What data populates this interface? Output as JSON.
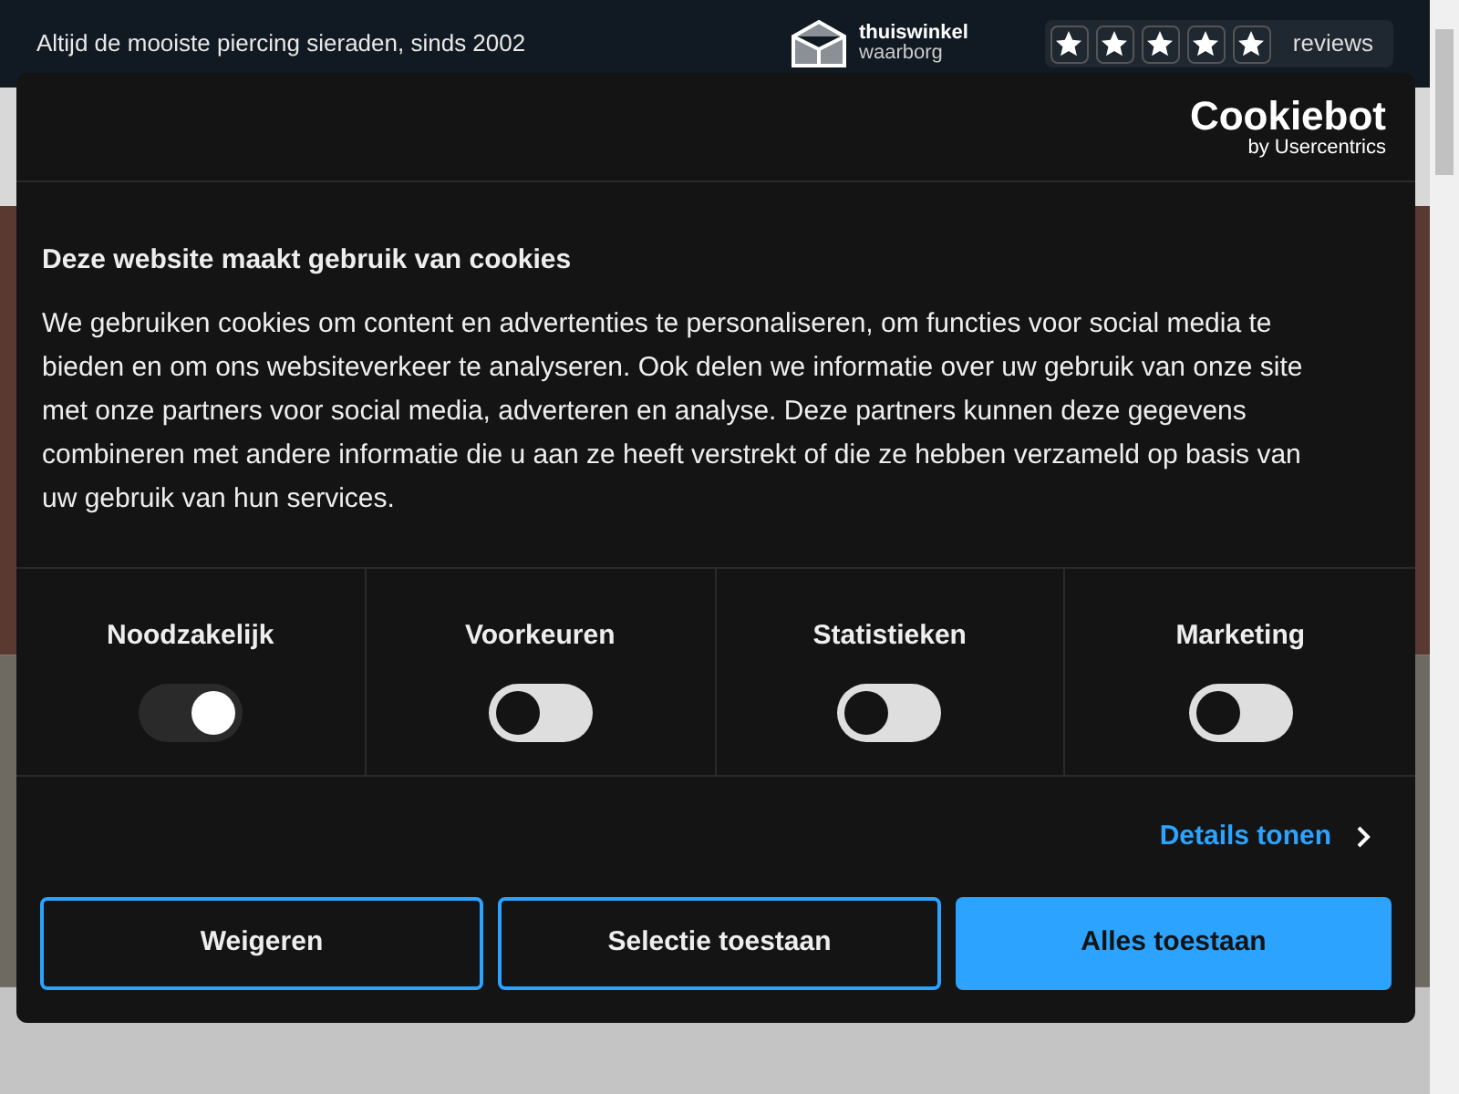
{
  "top_bar": {
    "tagline": "Altijd de mooiste piercing sieraden, sinds 2002",
    "trust_logo": {
      "name": "thuiswinkel",
      "sub": "waarborg"
    },
    "rating": {
      "stars": 5,
      "label": "reviews"
    }
  },
  "cookie_dialog": {
    "brand": {
      "name": "Cookiebot",
      "sub": "by Usercentrics"
    },
    "title": "Deze website maakt gebruik van cookies",
    "body": "We gebruiken cookies om content en advertenties te personaliseren, om functies voor social media te bieden en om ons websiteverkeer te analyseren. Ook delen we informatie over uw gebruik van onze site met onze partners voor social media, adverteren en analyse. Deze partners kunnen deze gegevens combineren met andere informatie die u aan ze heeft verstrekt of die ze hebben verzameld op basis van uw gebruik van hun services.",
    "categories": [
      {
        "label": "Noodzakelijk",
        "on": true,
        "disabled": true
      },
      {
        "label": "Voorkeuren",
        "on": false,
        "disabled": false
      },
      {
        "label": "Statistieken",
        "on": false,
        "disabled": false
      },
      {
        "label": "Marketing",
        "on": false,
        "disabled": false
      }
    ],
    "details_link": "Details tonen",
    "buttons": [
      {
        "label": "Weigeren",
        "kind": "outline"
      },
      {
        "label": "Selectie toestaan",
        "kind": "outline"
      },
      {
        "label": "Alles toestaan",
        "kind": "primary"
      }
    ]
  }
}
